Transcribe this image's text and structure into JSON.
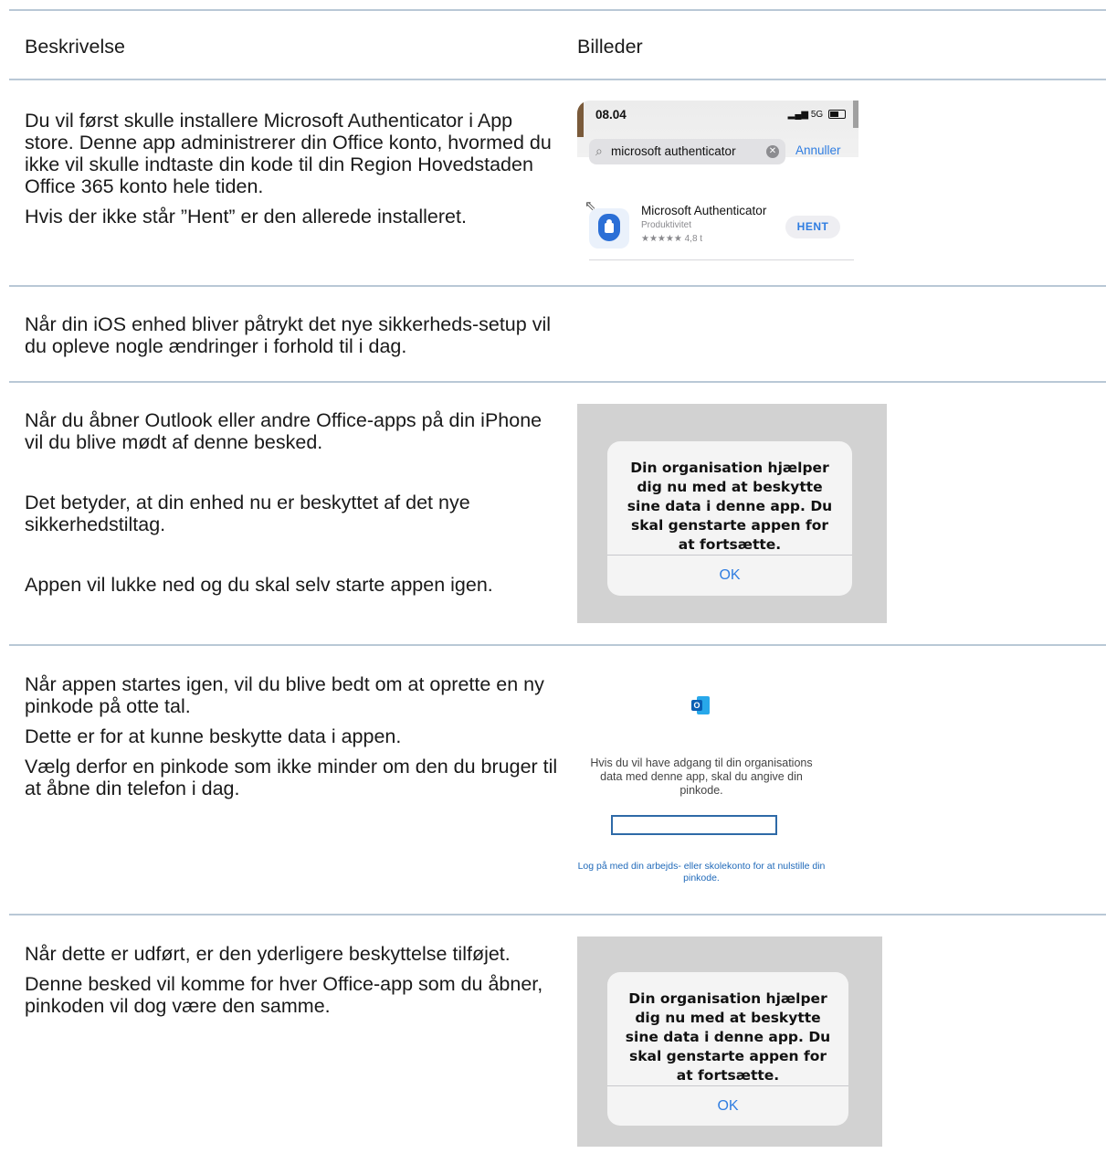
{
  "headers": {
    "description": "Beskrivelse",
    "images": "Billeder"
  },
  "rows": [
    {
      "paragraphs": [
        "Du vil først skulle installere Microsoft Authenticator i App store. Denne app administrerer din Office konto, hvormed du ikke vil skulle indtaste din kode til din Region Hovedstaden Office 365 konto hele tiden.",
        "Hvis der ikke står ”Hent” er den allerede installeret."
      ]
    },
    {
      "paragraphs": [
        "Når din iOS enhed bliver påtrykt det nye sikkerheds-setup vil du opleve nogle ændringer i forhold til i dag."
      ]
    },
    {
      "paragraphs": [
        "Når du åbner Outlook eller andre Office-apps på din iPhone vil du blive mødt af denne besked.",
        "Det betyder, at din enhed nu er beskyttet af det nye sikkerhedstiltag.",
        "Appen vil lukke ned og du skal selv starte appen igen."
      ]
    },
    {
      "paragraphs": [
        "Når appen startes igen, vil du blive bedt om at oprette en ny pinkode på otte tal.",
        "Dette er for at kunne beskytte data i appen.",
        "Vælg derfor en pinkode som ikke minder om den du bruger til at åbne din telefon i dag."
      ]
    },
    {
      "paragraphs": [
        "Når dette er udført, er den yderligere beskyttelse tilføjet.",
        "Denne besked vil komme for hver Office-app som du åbner, pinkoden vil dog være den samme."
      ]
    }
  ],
  "appstore_shot": {
    "time": "08.04",
    "network": "5G",
    "search_query": "microsoft authenticator",
    "cancel_label": "Annuller",
    "app_name": "Microsoft Authenticator",
    "app_category": "Produktivitet",
    "app_rating": "★★★★★ 4,8 t",
    "get_label": "HENT"
  },
  "dialog_shot": {
    "message": "Din organisation hjælper dig nu med at beskytte sine data i denne app. Du skal genstarte appen for at fortsætte.",
    "ok_label": "OK"
  },
  "pin_shot": {
    "prompt": "Hvis du vil have adgang til din organisations data med denne app, skal du angive din pinkode.",
    "reset_link": "Log på med din arbejds- eller skolekonto for at nulstille din pinkode."
  }
}
